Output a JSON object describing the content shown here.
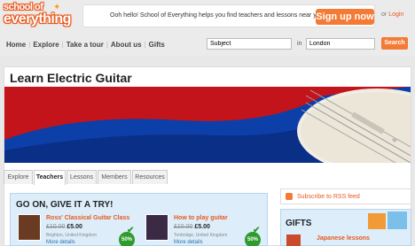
{
  "brand": {
    "logo_line1": "school of",
    "logo_line2": "everything",
    "accent": "#f47b35"
  },
  "header": {
    "promo_text": "Ooh hello! School of Everything helps you find teachers and lessons near you.",
    "signup_label": "Sign up now",
    "or_text": "or",
    "login_label": "Login"
  },
  "nav": {
    "items": [
      "Home",
      "Explore",
      "Take a tour",
      "About us",
      "Gifts"
    ],
    "subject_value": "Subject",
    "in_label": "in",
    "location_value": "London",
    "search_label": "Search"
  },
  "page": {
    "title": "Learn Electric Guitar"
  },
  "tabs": [
    {
      "label": "Explore"
    },
    {
      "label": "Teachers"
    },
    {
      "label": "Lessons"
    },
    {
      "label": "Members"
    },
    {
      "label": "Resources"
    }
  ],
  "goon": {
    "title": "GO ON, GIVE IT A TRY!",
    "cards": [
      {
        "title": "Ross' Classical Guitar Class",
        "old_price": "£10.00",
        "new_price": "£5.00",
        "location": "Brighton, United Kingdom",
        "more": "More details",
        "badge": "50%"
      },
      {
        "title": "How to play guitar",
        "old_price": "£10.00",
        "new_price": "£5.00",
        "location": "Tonbridge, United Kingdom",
        "more": "More details",
        "badge": "50%"
      }
    ]
  },
  "sidebar": {
    "rss_label": "Subscribe to RSS feed",
    "gifts_title": "GIFTS",
    "gift_item": "Japanese lessons"
  }
}
